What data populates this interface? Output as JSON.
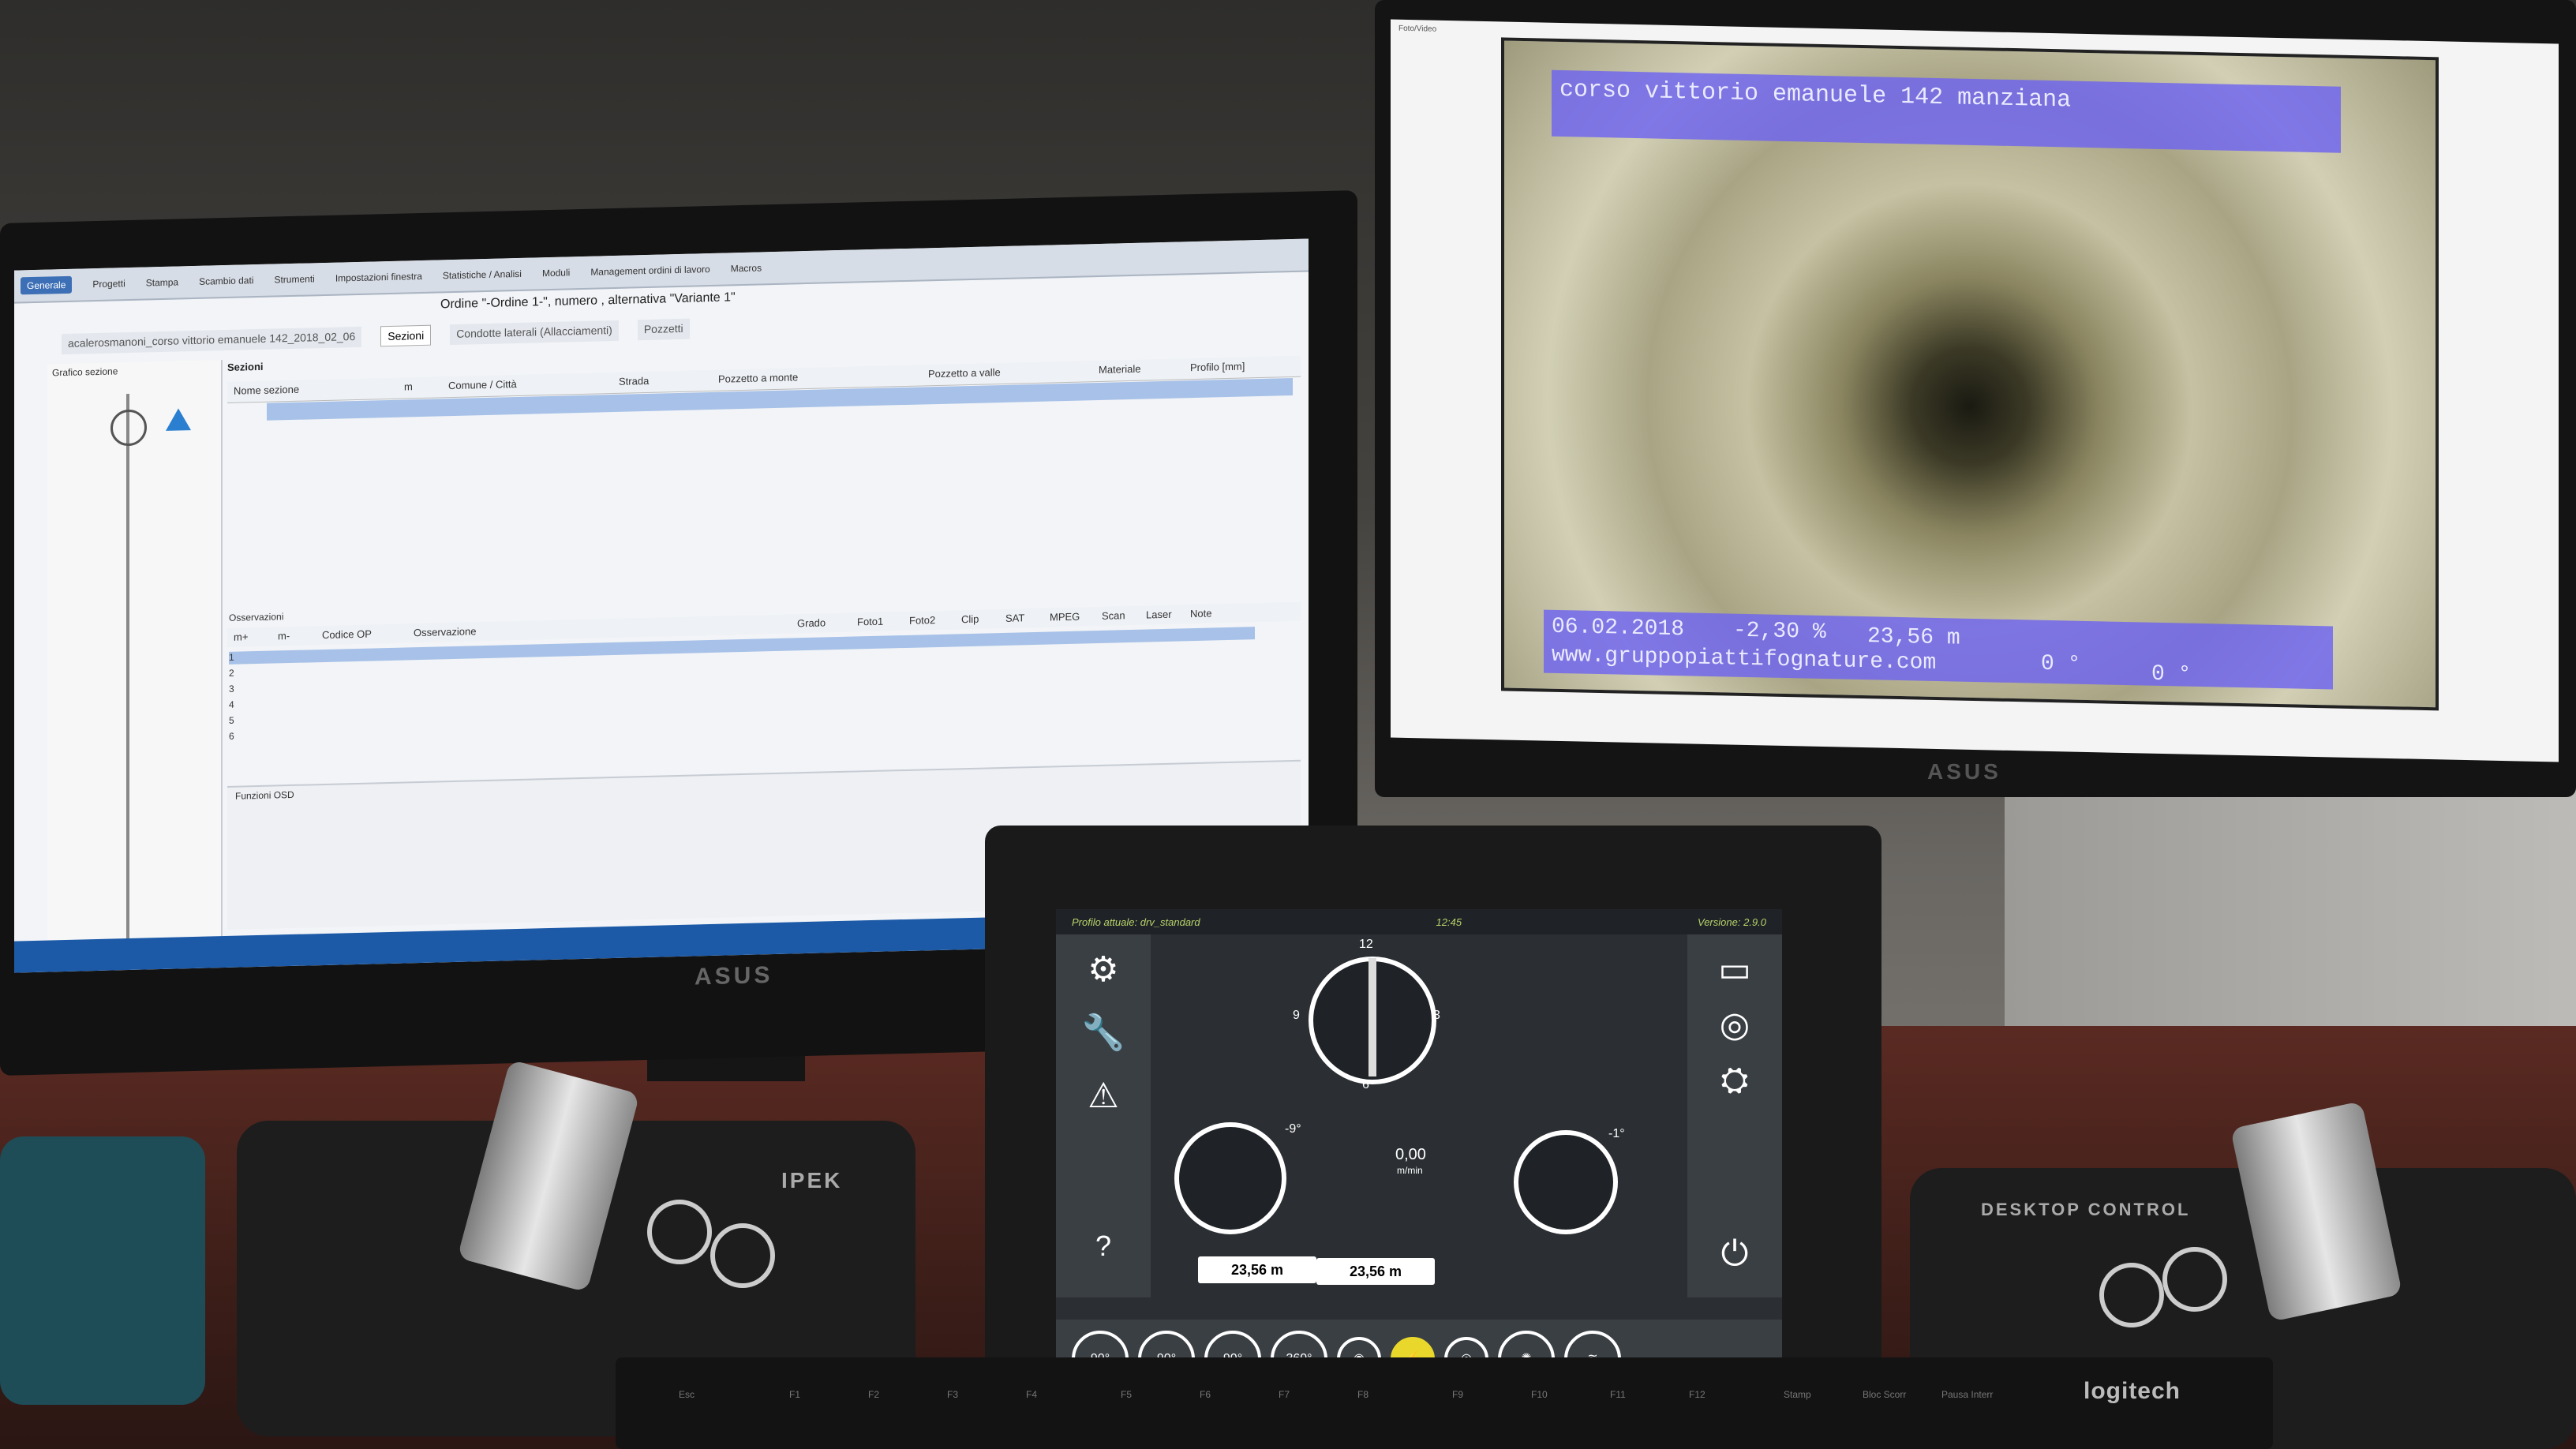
{
  "left_monitor": {
    "brand": "ASUS",
    "ribbon_tabs": [
      "Generale",
      "Progetti",
      "Stampa",
      "Scambio dati",
      "Strumenti",
      "Impostazioni finestra",
      "Statistiche / Analisi",
      "Moduli",
      "Management ordini di lavoro",
      "Macros"
    ],
    "order_title": "Ordine \"-Ordine 1-\", numero , alternativa \"Variante 1\"",
    "tabs": [
      "Sezioni",
      "Condotte laterali (Allacciamenti)",
      "Pozzetti"
    ],
    "project_name": "acalerosmanoni_corso vittorio emanuele 142_2018_02_06",
    "left_panel_title": "Grafico sezione",
    "sezioni_label": "Sezioni",
    "grid_columns": [
      "Nome sezione",
      "m",
      "Comune / Città",
      "Strada",
      "Pozzetto a monte",
      "Pozzetto a valle",
      "Materiale",
      "Profilo [mm]"
    ],
    "obs_label": "Osservazioni",
    "obs_columns": [
      "m+",
      "m-",
      "Codice OP",
      "Osservazione",
      "Grado",
      "Foto1",
      "Foto2",
      "Clip",
      "SAT",
      "MPEG",
      "Scan",
      "Laser",
      "Note"
    ],
    "obs_row_numbers": [
      "1",
      "2",
      "3",
      "4",
      "5",
      "6"
    ],
    "bottom_label": "Funzioni OSD"
  },
  "right_monitor": {
    "brand": "ASUS",
    "window_title": "Foto/Video",
    "video_top_text": "corso vittorio emanuele 142 manziana",
    "osd_date": "06.02.2018",
    "osd_incline": "-2,30 %",
    "osd_distance": "23,56 m",
    "osd_website": "www.gruppopiattifognature.com",
    "osd_angle_1": "0 °",
    "osd_angle_2": "0 °"
  },
  "tablet": {
    "profile_label": "Profilo attuale:",
    "profile_value": "drv_standard",
    "time": "12:45",
    "version_label": "Versione:",
    "version_value": "2.9.0",
    "compass_top": "12",
    "compass_left": "9",
    "compass_right": "3",
    "compass_bottom": "6",
    "speed_value": "0,00",
    "speed_unit": "m/min",
    "tilt_left": "-9°",
    "tilt_right": "-1°",
    "readout_left": "23,56 m",
    "readout_right": "23,56 m",
    "btn_rot_left": "90°",
    "btn_rot_mid": "90°",
    "btn_rot_right": "90°",
    "btn_360": "360°",
    "help_icon": "question-icon",
    "power_icon": "power-icon",
    "warning_icon": "warning-icon",
    "wrench_icon": "wrench-icon",
    "accent": "#b8d26a"
  },
  "controllers": {
    "left_brand": "IPEK",
    "right_brand": "DESKTOP CONTROL",
    "keyboard_brand": "logitech",
    "keyboard_keys": [
      "Esc",
      "F1",
      "F2",
      "F3",
      "F4",
      "F5",
      "F6",
      "F7",
      "F8",
      "F9",
      "F10",
      "F11",
      "F12",
      "Stamp",
      "Bloc Scorr",
      "Pausa Interr"
    ]
  }
}
